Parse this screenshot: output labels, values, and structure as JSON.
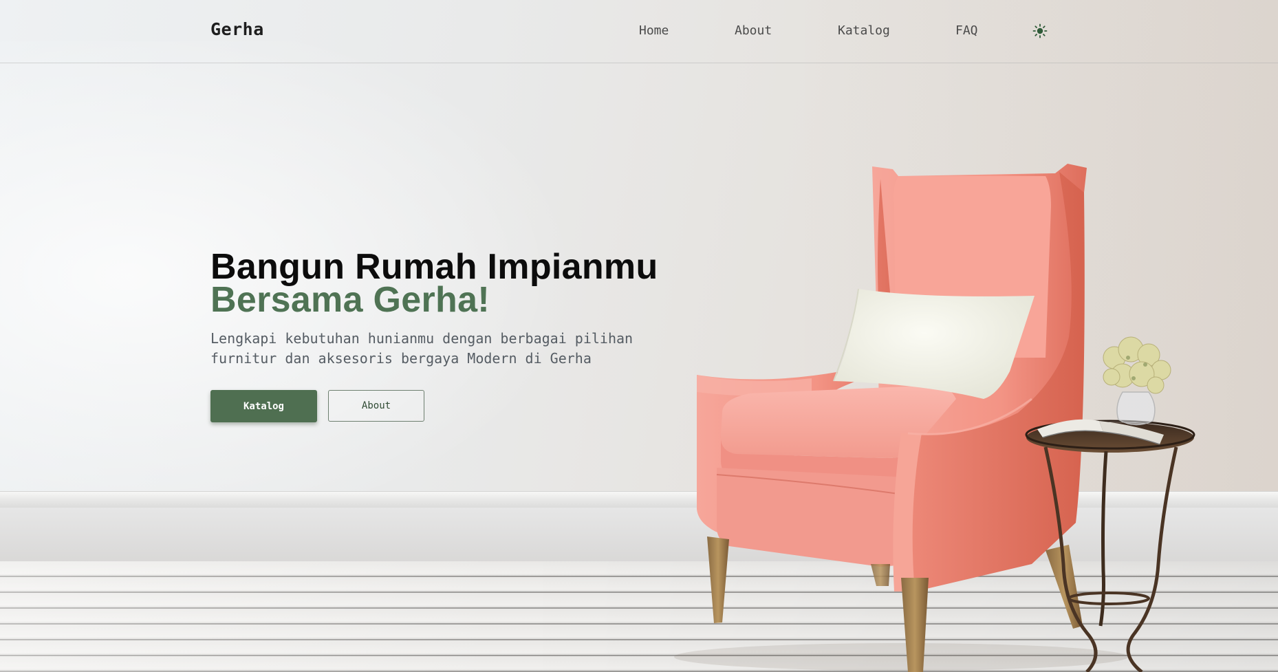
{
  "brand": {
    "name": "Gerha"
  },
  "nav": {
    "home": "Home",
    "about": "About",
    "katalog": "Katalog",
    "faq": "FAQ",
    "theme_icon": "sun-icon"
  },
  "hero": {
    "title_line1": "Bangun Rumah Impianmu",
    "title_line2": "Bersama Gerha!",
    "subtitle": "Lengkapi kebutuhan hunianmu dengan berbagai pilihan furnitur dan aksesoris bergaya Modern di Gerha",
    "primary_button": "Katalog",
    "secondary_button": "About"
  },
  "colors": {
    "accent": "#4f6f51",
    "accent_text": "#4f7354",
    "chair": "#f29a8e"
  }
}
